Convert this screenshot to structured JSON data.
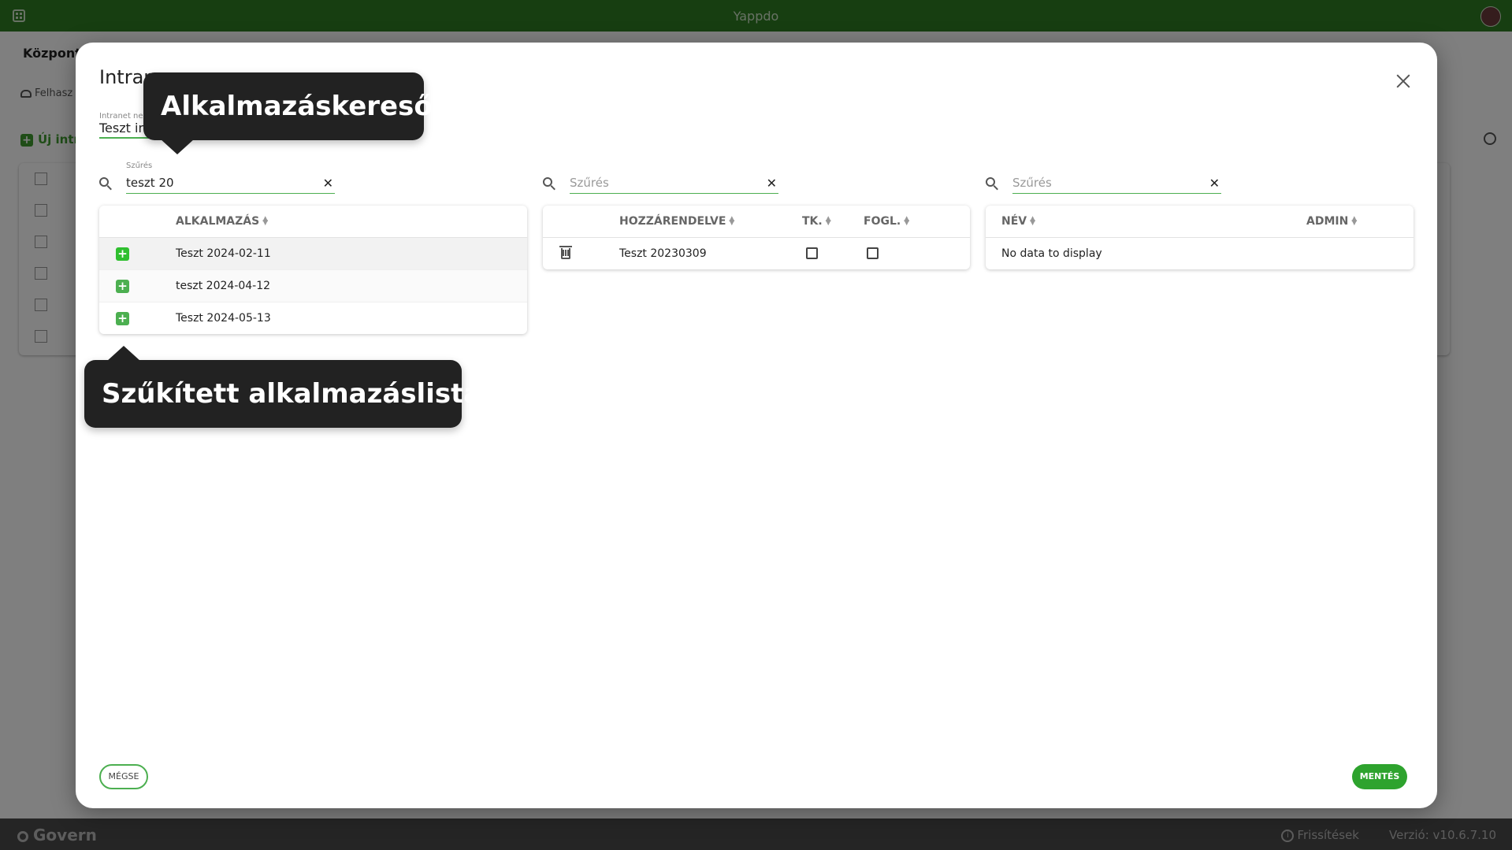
{
  "app": {
    "title": "Yappdo"
  },
  "background": {
    "nav_label": "Központi",
    "subnav_label": "Felhasz",
    "new_button_label": "Új intr"
  },
  "dialog": {
    "title": "Intran",
    "name_field": {
      "label": "Intranet ne",
      "value": "Teszt int"
    },
    "apps_panel": {
      "filter": {
        "label": "Szűrés",
        "value": "teszt 20",
        "placeholder": "Szűrés"
      },
      "column_header": "ALKALMAZÁS",
      "rows": [
        {
          "name": "Teszt 2024-02-11"
        },
        {
          "name": "teszt 2024-04-12"
        },
        {
          "name": "Teszt 2024-05-13"
        }
      ]
    },
    "assigned_panel": {
      "filter": {
        "placeholder": "Szűrés"
      },
      "headers": {
        "assigned": "HOZZÁRENDELVE",
        "tk": "TK.",
        "fogl": "FOGL."
      },
      "rows": [
        {
          "name": "Teszt 20230309",
          "tk": false,
          "fogl": false
        }
      ]
    },
    "users_panel": {
      "filter": {
        "placeholder": "Szűrés"
      },
      "headers": {
        "name": "NÉV",
        "admin": "ADMIN"
      },
      "empty_text": "No data to display"
    },
    "cancel_label": "MÉGSE",
    "save_label": "MENTÉS"
  },
  "callouts": {
    "search": "Alkalmazáskereső",
    "list": "Szűkített alkalmazáslista"
  },
  "footer": {
    "brand": "Govern",
    "updates": "Frissítések",
    "version": "Verzió: v10.6.7.10"
  },
  "colors": {
    "brand_green": "#2f7d23",
    "accent_green": "#4caf50",
    "callout_bg": "#222222"
  }
}
